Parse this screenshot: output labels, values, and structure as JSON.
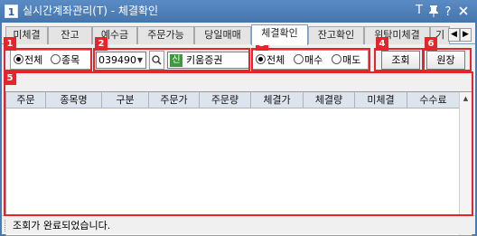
{
  "window": {
    "app_badge": "1",
    "title": "실시간계좌관리(T) - 체결확인",
    "controls": {
      "t_label": "T"
    }
  },
  "tabs": [
    {
      "label": "미체결"
    },
    {
      "label": "잔고"
    },
    {
      "label": "예수금"
    },
    {
      "label": "주문가능"
    },
    {
      "label": "당일매매"
    },
    {
      "label": "체결확인",
      "active": true
    },
    {
      "label": "잔고확인"
    },
    {
      "label": "위탁미체결"
    },
    {
      "label": "기"
    }
  ],
  "filter_scope": {
    "options": [
      {
        "label": "전체",
        "selected": true
      },
      {
        "label": "종목",
        "selected": false
      }
    ]
  },
  "stock": {
    "code": "039490",
    "badge": "신",
    "name": "키움증권"
  },
  "trade_type": {
    "options": [
      {
        "label": "전체",
        "selected": true
      },
      {
        "label": "매수",
        "selected": false
      },
      {
        "label": "매도",
        "selected": false
      }
    ]
  },
  "buttons": {
    "query": "조회",
    "ledger": "원장"
  },
  "table": {
    "columns": [
      "주문",
      "종목명",
      "구분",
      "주문가",
      "주문량",
      "체결가",
      "체결량",
      "미체결",
      "수수료"
    ],
    "rows": []
  },
  "status": {
    "message": "조회가 완료되었습니다."
  },
  "annotations": {
    "color": "#e8232b",
    "labels": [
      "1",
      "2",
      "3",
      "4",
      "5",
      "6"
    ]
  }
}
